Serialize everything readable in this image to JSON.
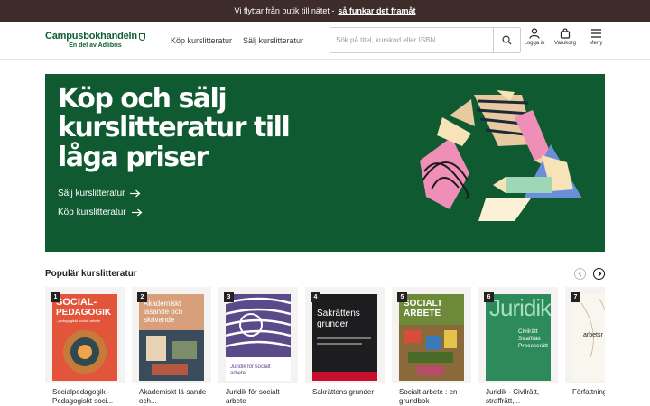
{
  "announcement": {
    "text": "Vi flyttar från butik till nätet -",
    "link": "så funkar det framåt"
  },
  "header": {
    "logo_main": "Campusbokhandeln",
    "logo_sub": "En del av Adlibris",
    "nav": [
      "Köp kurslitteratur",
      "Sälj kurslitteratur"
    ],
    "search_placeholder": "Sök på titel, kurskod eller ISBN",
    "login_label": "Logga in",
    "cart_label": "Varukorg",
    "menu_label": "Meny"
  },
  "hero": {
    "title": "Köp och sälj kurslitteratur till låga priser",
    "link_sell": "Sälj kurslitteratur",
    "link_buy": "Köp kurslitteratur"
  },
  "popular": {
    "title": "Populär kurslitteratur",
    "books": [
      {
        "rank": "1",
        "title": "Socialpedagogik - Pedagogiskt soci...",
        "cover_top": "SOCIAL-",
        "cover_main": "PEDAGOGIK",
        "cover_sub": "- pedagogiskt socialt arbete"
      },
      {
        "rank": "2",
        "title": "Akademiskt lä-sande och...",
        "cover_main": "Akademiskt läsande och skrivande"
      },
      {
        "rank": "3",
        "title": "Juridik för socialt arbete",
        "cover_main": "Juridik för socialt arbete"
      },
      {
        "rank": "4",
        "title": "Sakrättens grunder",
        "cover_main": "Sakrättens grunder"
      },
      {
        "rank": "5",
        "title": "Socialt arbete : en grundbok",
        "cover_main": "SOCIALT ARBETE"
      },
      {
        "rank": "6",
        "title": "Juridik - Civilrätt, straffrätt,...",
        "cover_main": "Juridik",
        "cover_sub": "Civilrätt Straffrätt Processrätt"
      },
      {
        "rank": "7",
        "title": "Författning rättsfallsi...",
        "cover_main": "arbetsr"
      }
    ]
  },
  "colors": {
    "brand_green": "#0f5a30",
    "announce_bg": "#3d2c29"
  }
}
